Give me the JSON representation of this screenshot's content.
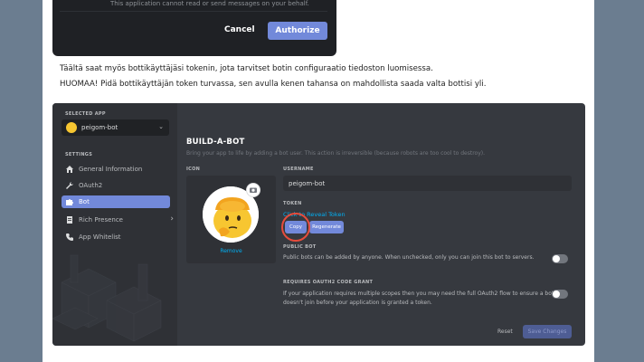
{
  "oauth": {
    "note": "This application cannot read or send messages on your behalf.",
    "cancel": "Cancel",
    "authorize": "Authorize"
  },
  "text": {
    "para1": "Täältä saat myös bottikäyttäjäsi tokenin, jota tarvitset botin configuraatio tiedoston luomisessa.",
    "para2": "HUOMAA! Pidä bottikäyttäjän token turvassa, sen avulla kenen tahansa on mahdollista saada valta bottisi yli."
  },
  "sidebar": {
    "selected_app_label": "SELECTED APP",
    "app_name": "peigom-bot",
    "settings_label": "SETTINGS",
    "items": [
      {
        "label": "General Information",
        "icon": "home-icon"
      },
      {
        "label": "OAuth2",
        "icon": "wrench-icon"
      },
      {
        "label": "Bot",
        "icon": "puzzle-icon"
      },
      {
        "label": "Rich Presence",
        "icon": "document-icon"
      },
      {
        "label": "App Whitelist",
        "icon": "phone-icon"
      }
    ]
  },
  "main": {
    "title": "BUILD-A-BOT",
    "description": "Bring your app to life by adding a bot user. This action is irreversible (because robots are too cool to destroy).",
    "icon_label": "ICON",
    "remove": "Remove",
    "username_label": "USERNAME",
    "username_value": "peigom-bot",
    "token_label": "TOKEN",
    "token_link": "Click to Reveal Token",
    "copy": "Copy",
    "regenerate": "Regenerate",
    "public_bot_label": "PUBLIC BOT",
    "public_bot_desc": "Public bots can be added by anyone. When unchecked, only you can join this bot to servers.",
    "oauth_grant_label": "REQUIRES OAUTH2 CODE GRANT",
    "oauth_grant_desc": "If your application requires multiple scopes then you may need the full OAuth2 flow to ensure a bot doesn't join before your application is granted a token.",
    "reset": "Reset",
    "save": "Save Changes"
  },
  "colors": {
    "accent": "#7289da",
    "link": "#00b0f4",
    "highlight_circle": "#e74c3c",
    "background": "#6b7d90"
  }
}
